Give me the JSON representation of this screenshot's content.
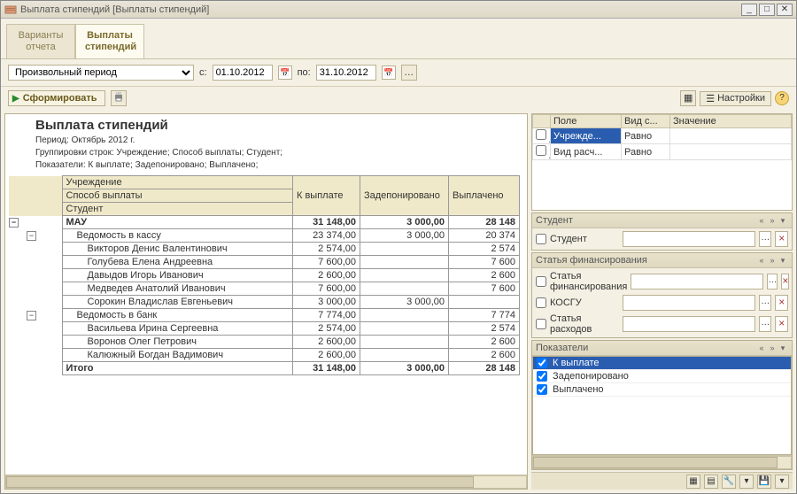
{
  "window": {
    "title": "Выплата стипендий [Выплаты стипендий]"
  },
  "tabs": {
    "inactive": "Варианты\nотчета",
    "active": "Выплаты\nстипендий"
  },
  "toolbar1": {
    "period_mode": "Произвольный период",
    "from_label": "с:",
    "from": "01.10.2012",
    "to_label": "по:",
    "to": "31.10.2012"
  },
  "toolbar2": {
    "form_label": "Сформировать",
    "settings_label": "Настройки"
  },
  "report": {
    "title": "Выплата стипендий",
    "period": "Период: Октябрь 2012 г.",
    "group": "Группировки строк: Учреждение; Способ выплаты; Студент;",
    "indic": "Показатели: К выплате; Задепонировано; Выплачено;",
    "col_group1": "Учреждение",
    "col_group2": "Способ выплаты",
    "col_group3": "Студент",
    "col_to_pay": "К выплате",
    "col_depo": "Задепонировано",
    "col_paid": "Выплачено",
    "rows": [
      {
        "lvl": 0,
        "name": "МАУ",
        "to_pay": "31 148,00",
        "depo": "3 000,00",
        "paid": "28 148",
        "bold": true
      },
      {
        "lvl": 1,
        "name": "Ведомость в кассу",
        "to_pay": "23 374,00",
        "depo": "3 000,00",
        "paid": "20 374"
      },
      {
        "lvl": 2,
        "name": "Викторов Денис Валентинович",
        "to_pay": "2 574,00",
        "depo": "",
        "paid": "2 574"
      },
      {
        "lvl": 2,
        "name": "Голубева Елена Андреевна",
        "to_pay": "7 600,00",
        "depo": "",
        "paid": "7 600"
      },
      {
        "lvl": 2,
        "name": "Давыдов Игорь Иванович",
        "to_pay": "2 600,00",
        "depo": "",
        "paid": "2 600"
      },
      {
        "lvl": 2,
        "name": "Медведев Анатолий Иванович",
        "to_pay": "7 600,00",
        "depo": "",
        "paid": "7 600"
      },
      {
        "lvl": 2,
        "name": "Сорокин Владислав Евгеньевич",
        "to_pay": "3 000,00",
        "depo": "3 000,00",
        "paid": ""
      },
      {
        "lvl": 1,
        "name": "Ведомость в банк",
        "to_pay": "7 774,00",
        "depo": "",
        "paid": "7 774"
      },
      {
        "lvl": 2,
        "name": "Васильева Ирина Сергеевна",
        "to_pay": "2 574,00",
        "depo": "",
        "paid": "2 574"
      },
      {
        "lvl": 2,
        "name": "Воронов Олег Петрович",
        "to_pay": "2 600,00",
        "depo": "",
        "paid": "2 600"
      },
      {
        "lvl": 2,
        "name": "Калюжный Богдан Вадимович",
        "to_pay": "2 600,00",
        "depo": "",
        "paid": "2 600"
      }
    ],
    "total_label": "Итого",
    "total_to_pay": "31 148,00",
    "total_depo": "3 000,00",
    "total_paid": "28 148"
  },
  "filter": {
    "h_field": "Поле",
    "h_cond": "Вид с...",
    "h_value": "Значение",
    "r1_field": "Учрежде...",
    "r1_cond": "Равно",
    "r2_field": "Вид расч...",
    "r2_cond": "Равно"
  },
  "panels": {
    "student": "Студент",
    "student_lbl": "Студент",
    "fin": "Статья финансирования",
    "fin_lbl": "Статья финансирования",
    "kosgu_lbl": "КОСГУ",
    "exp_lbl": "Статья расходов",
    "ind": "Показатели",
    "ind1": "К выплате",
    "ind2": "Задепонировано",
    "ind3": "Выплачено"
  }
}
